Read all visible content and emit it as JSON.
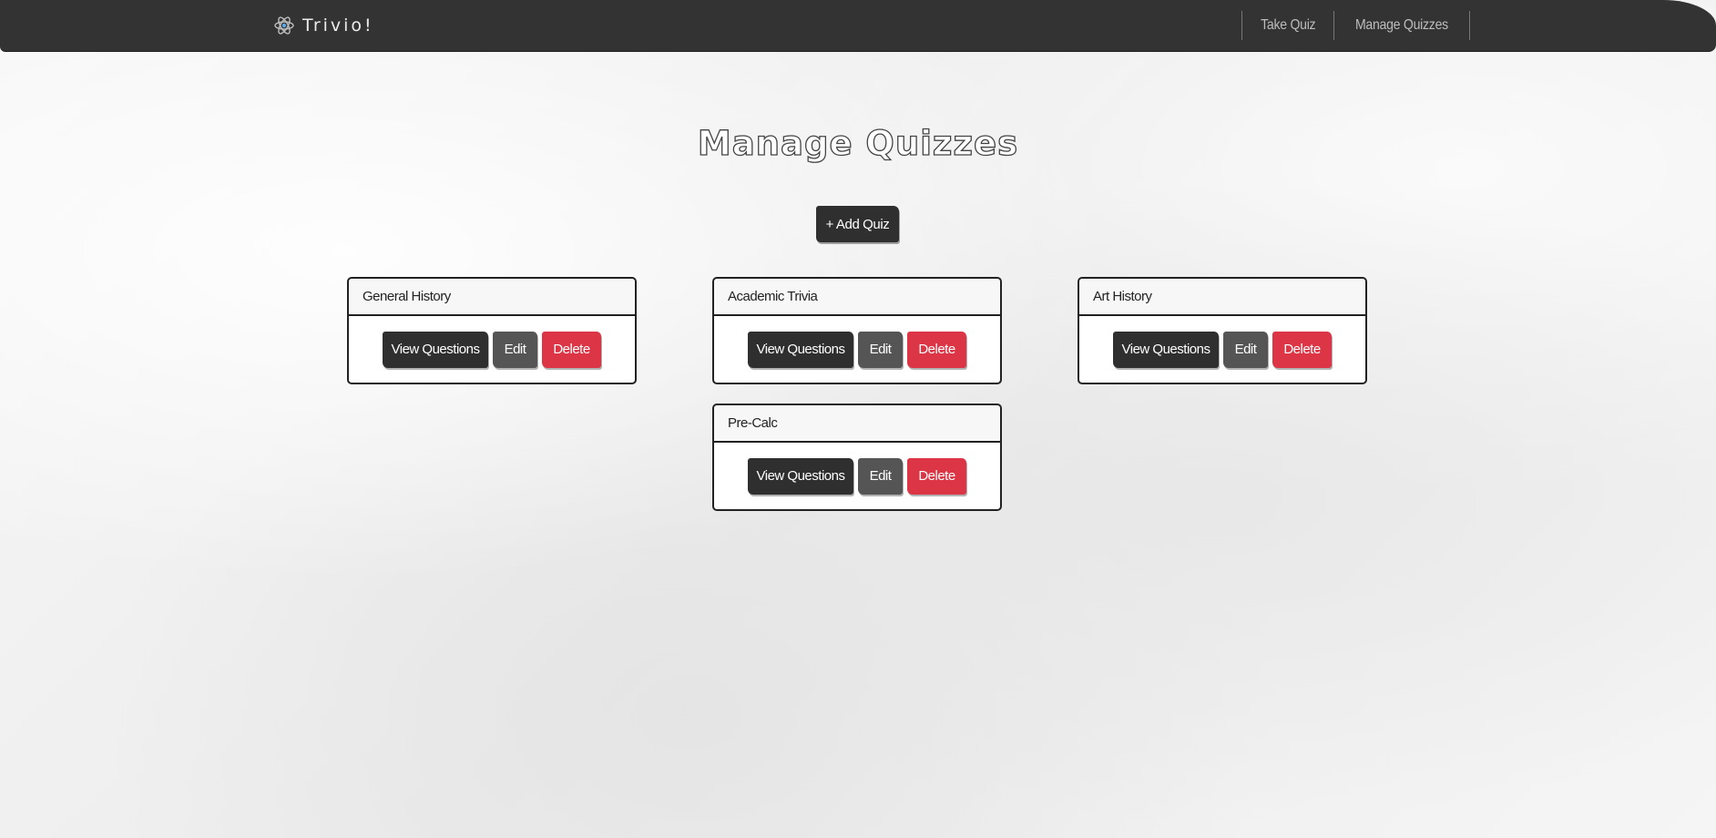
{
  "navbar": {
    "brand": "Trivio!",
    "links": [
      "Take Quiz",
      "Manage Quizzes"
    ]
  },
  "page": {
    "title": "Manage Quizzes",
    "add_button": "+ Add Quiz"
  },
  "buttons": {
    "view": "View Questions",
    "edit": "Edit",
    "delete": "Delete"
  },
  "quizzes": [
    {
      "title": "General History"
    },
    {
      "title": "Academic Trivia"
    },
    {
      "title": "Art History"
    },
    {
      "title": "Pre-Calc"
    }
  ],
  "colors": {
    "navbar": "#333333",
    "primary_button": "#2f2f2f",
    "secondary_button": "#555555",
    "danger_button": "#dc3545",
    "atom_accent": "#5aa9e6"
  },
  "icons": {
    "brand": "atom-icon"
  }
}
